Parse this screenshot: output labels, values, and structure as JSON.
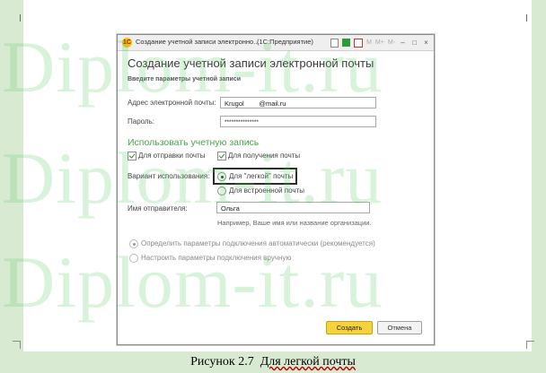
{
  "window": {
    "logo": "1С",
    "title": "Создание учетной записи электронно...",
    "app_name": "(1С:Предприятие)",
    "title_icons": [
      "document-icon",
      "green-table-icon",
      "calendar-icon",
      "memory-m-icon",
      "memory-mplus-icon",
      "memory-mminus-icon",
      "minimize-icon",
      "maximize-icon",
      "close-icon"
    ],
    "title_icon_glyphs": {
      "m": "M",
      "mplus": "M+",
      "mminus": "M-",
      "min": "–",
      "max": "□",
      "close": "×"
    }
  },
  "form": {
    "heading": "Создание учетной записи электронной почты",
    "subtitle": "Введите параметры учетной записи",
    "email_label": "Адрес электронной почты:",
    "email_value": "Krugol        @mail.ru",
    "password_label": "Пароль:",
    "password_value": "***************",
    "section_title": "Использовать учетную запись",
    "send_label": "Для отправки почты",
    "receive_label": "Для получения почты",
    "variant_label": "Вариант использования:",
    "variant_light": "Для \"легкой\" почты",
    "variant_builtin": "Для встроенной почты",
    "sender_label": "Имя отправителя:",
    "sender_value": "Ольга",
    "sender_hint": "Например, Ваше имя или название организации.",
    "auto_params": "Определить параметры подключения автоматически (рекомендуется)",
    "manual_params": "Настроить параметры подключения вручную",
    "create_button": "Создать",
    "cancel_button": "Отмена"
  },
  "state": {
    "send_checked": true,
    "receive_checked": true,
    "variant_selected": "light",
    "connection_mode": "auto"
  },
  "caption": {
    "prefix": "Рисунок 2.7",
    "text": "Для легкой почты"
  },
  "watermark": "Diplom-it.ru",
  "colors": {
    "accent_green": "#4aa24a",
    "create_button": "#f6d23c",
    "page_background": "#d9ead3"
  }
}
